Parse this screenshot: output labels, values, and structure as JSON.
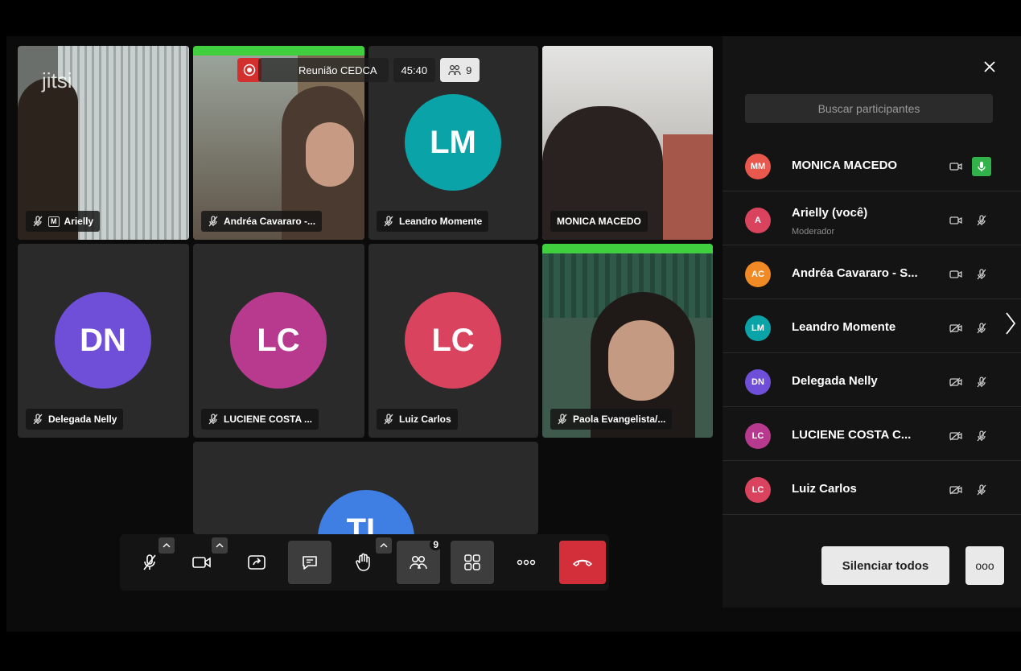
{
  "meeting": {
    "title": "Reunião CEDCA",
    "timer": "45:40",
    "participant_count": "9",
    "logo": "jitsi"
  },
  "tiles": [
    {
      "name": "Arielly",
      "moderator_badge": "M",
      "type": "video"
    },
    {
      "name": "Andréa Cavararo -...",
      "type": "video"
    },
    {
      "name": "Leandro Momente",
      "initials": "LM",
      "color": "#0aa3a8",
      "type": "avatar"
    },
    {
      "name": "MONICA MACEDO",
      "type": "video",
      "active": true
    },
    {
      "name": "Delegada Nelly",
      "initials": "DN",
      "color": "#6f4fd8",
      "type": "avatar"
    },
    {
      "name": "LUCIENE COSTA ...",
      "initials": "LC",
      "color": "#b83a8e",
      "type": "avatar"
    },
    {
      "name": "Luiz Carlos",
      "initials": "LC",
      "color": "#d9435e",
      "type": "avatar"
    },
    {
      "name": "Paola Evangelista/...",
      "type": "video"
    },
    {
      "name": "",
      "initials": "TL",
      "color": "#3f7fe3",
      "type": "avatar"
    }
  ],
  "toolbar": {
    "participants_badge": "9",
    "icons": [
      "mic-off-icon",
      "camera-icon",
      "screen-share-icon",
      "chat-icon",
      "raise-hand-icon",
      "participants-icon",
      "tile-view-icon",
      "more-icon",
      "hangup-icon"
    ]
  },
  "panel": {
    "search_placeholder": "Buscar participantes",
    "participants": [
      {
        "initials": "MM",
        "name": "MONICA MACEDO",
        "role": "",
        "color": "#e8584d",
        "video": "on",
        "mic": "speaking"
      },
      {
        "initials": "A",
        "name": "Arielly (você)",
        "role": "Moderador",
        "color": "#d9435e",
        "video": "on",
        "mic": "off"
      },
      {
        "initials": "AC",
        "name": "Andréa Cavararo - S...",
        "role": "",
        "color": "#f08a24",
        "video": "on",
        "mic": "off"
      },
      {
        "initials": "LM",
        "name": "Leandro Momente",
        "role": "",
        "color": "#0aa3a8",
        "video": "off",
        "mic": "off"
      },
      {
        "initials": "DN",
        "name": "Delegada Nelly",
        "role": "",
        "color": "#6f4fd8",
        "video": "off",
        "mic": "off"
      },
      {
        "initials": "LC",
        "name": "LUCIENE COSTA C...",
        "role": "",
        "color": "#b83a8e",
        "video": "off",
        "mic": "off"
      },
      {
        "initials": "LC",
        "name": "Luiz Carlos",
        "role": "",
        "color": "#d9435e",
        "video": "off",
        "mic": "off"
      }
    ],
    "mute_all_label": "Silenciar todos",
    "more_label": "ooo"
  }
}
